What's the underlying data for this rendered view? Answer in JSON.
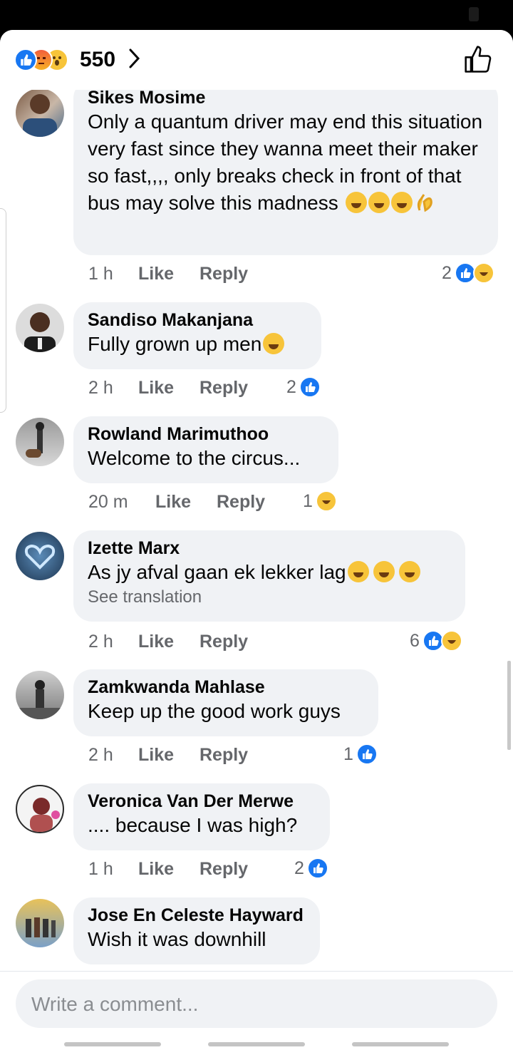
{
  "header": {
    "reaction_count": "550",
    "reactions": [
      "like",
      "angry",
      "wow"
    ]
  },
  "comments": [
    {
      "author": "Sikes Mosime",
      "text": "Only a quantum driver may end this situation very fast since they wanna meet their maker so fast,,,, only breaks check in front of that bus may solve this madness",
      "emoji": [
        "rofl",
        "rofl",
        "grin",
        "ok-hand"
      ],
      "time": "1 h",
      "like": "Like",
      "reply": "Reply",
      "reaction_count": "2",
      "reactions": [
        "like",
        "haha"
      ]
    },
    {
      "author": "Sandiso Makanjana",
      "text": "Fully grown up men",
      "emoji": [
        "unamused"
      ],
      "time": "2 h",
      "like": "Like",
      "reply": "Reply",
      "reaction_count": "2",
      "reactions": [
        "like"
      ]
    },
    {
      "author": "Rowland Marimuthoo",
      "text": "Welcome to the circus...",
      "time": "20 m",
      "like": "Like",
      "reply": "Reply",
      "reaction_count": "1",
      "reactions": [
        "haha"
      ]
    },
    {
      "author": "Izette Marx",
      "text": "As jy afval gaan ek lekker lag",
      "emoji": [
        "grin",
        "grin",
        "grin"
      ],
      "see_translation": "See translation",
      "time": "2 h",
      "like": "Like",
      "reply": "Reply",
      "reaction_count": "6",
      "reactions": [
        "like",
        "haha"
      ]
    },
    {
      "author": "Zamkwanda Mahlase",
      "text": "Keep up the good work guys",
      "time": "2 h",
      "like": "Like",
      "reply": "Reply",
      "reaction_count": "1",
      "reactions": [
        "like"
      ]
    },
    {
      "author": "Veronica Van Der Merwe",
      "text": ".... because I was high?",
      "time": "1 h",
      "like": "Like",
      "reply": "Reply",
      "reaction_count": "2",
      "reactions": [
        "like"
      ]
    },
    {
      "author": "Jose En Celeste Hayward",
      "text": "Wish it was downhill"
    }
  ],
  "composer": {
    "placeholder": "Write a comment..."
  }
}
